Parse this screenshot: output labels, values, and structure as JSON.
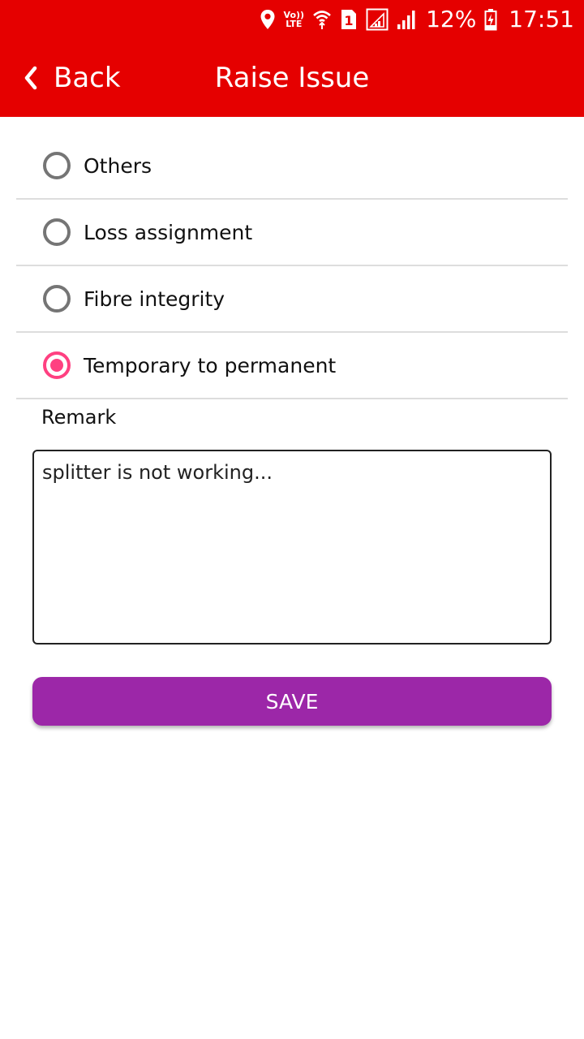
{
  "colors": {
    "app_bar": "#e50000",
    "radio_selected": "#ff4081",
    "radio_unselected": "#757575",
    "save_button": "#9c27a8",
    "divider": "#dddddd"
  },
  "status_bar": {
    "icons": [
      "location-icon",
      "volte-icon",
      "wifi-icon",
      "sim-1-icon",
      "signal-icon",
      "signal-icon",
      "battery-charging-icon"
    ],
    "volte_top": "Vo))",
    "volte_bottom": "LTE",
    "sim_number": "1",
    "battery_percent": "12%",
    "time": "17:51"
  },
  "toolbar": {
    "back_icon": "chevron-left-icon",
    "back_label": "Back",
    "title": "Raise Issue"
  },
  "issue_options": [
    {
      "label": "Others",
      "selected": false
    },
    {
      "label": "Loss assignment",
      "selected": false
    },
    {
      "label": "Fibre integrity",
      "selected": false
    },
    {
      "label": "Temporary to permanent",
      "selected": true
    }
  ],
  "remark": {
    "label": "Remark",
    "value": "splitter is not working..."
  },
  "save_button": {
    "label": "SAVE"
  }
}
